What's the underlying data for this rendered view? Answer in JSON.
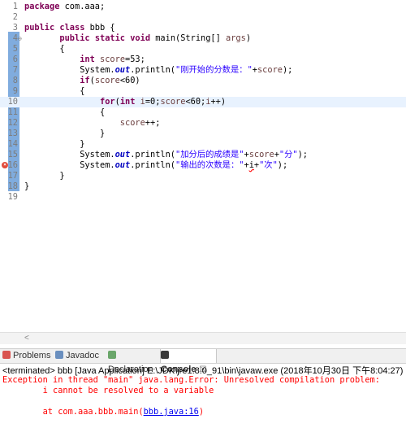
{
  "editor": {
    "lines": [
      {
        "n": "1",
        "code": [
          {
            "t": "package",
            "k": "kw"
          },
          {
            "t": " com.aaa;",
            "k": ""
          }
        ]
      },
      {
        "n": "2",
        "code": []
      },
      {
        "n": "3",
        "code": [
          {
            "t": "public",
            "k": "kw"
          },
          {
            "t": " ",
            "k": ""
          },
          {
            "t": "class",
            "k": "kw"
          },
          {
            "t": " bbb {",
            "k": ""
          }
        ]
      },
      {
        "n": "4",
        "fold": "⊖",
        "code": [
          {
            "t": "       ",
            "k": ""
          },
          {
            "t": "public",
            "k": "kw"
          },
          {
            "t": " ",
            "k": ""
          },
          {
            "t": "static",
            "k": "kw"
          },
          {
            "t": " ",
            "k": ""
          },
          {
            "t": "void",
            "k": "kw"
          },
          {
            "t": " main(String[] ",
            "k": ""
          },
          {
            "t": "args",
            "k": "var"
          },
          {
            "t": ")",
            "k": ""
          }
        ]
      },
      {
        "n": "5",
        "code": [
          {
            "t": "       {",
            "k": ""
          }
        ]
      },
      {
        "n": "6",
        "code": [
          {
            "t": "           ",
            "k": ""
          },
          {
            "t": "int",
            "k": "kw"
          },
          {
            "t": " ",
            "k": ""
          },
          {
            "t": "score",
            "k": "var"
          },
          {
            "t": "=53;",
            "k": ""
          }
        ]
      },
      {
        "n": "7",
        "code": [
          {
            "t": "           System.",
            "k": ""
          },
          {
            "t": "out",
            "k": "fld"
          },
          {
            "t": ".println(",
            "k": ""
          },
          {
            "t": "\"刚开始的分数是：\"",
            "k": "str"
          },
          {
            "t": "+",
            "k": ""
          },
          {
            "t": "score",
            "k": "var"
          },
          {
            "t": ");",
            "k": ""
          }
        ]
      },
      {
        "n": "8",
        "code": [
          {
            "t": "           ",
            "k": ""
          },
          {
            "t": "if",
            "k": "kw"
          },
          {
            "t": "(",
            "k": ""
          },
          {
            "t": "score",
            "k": "var"
          },
          {
            "t": "<60)",
            "k": ""
          }
        ]
      },
      {
        "n": "9",
        "code": [
          {
            "t": "           {",
            "k": ""
          }
        ]
      },
      {
        "n": "10",
        "current": true,
        "code": [
          {
            "t": "               ",
            "k": ""
          },
          {
            "t": "for",
            "k": "kw"
          },
          {
            "t": "(",
            "k": ""
          },
          {
            "t": "int",
            "k": "kw"
          },
          {
            "t": " ",
            "k": ""
          },
          {
            "t": "i",
            "k": "var"
          },
          {
            "t": "=0;",
            "k": ""
          },
          {
            "t": "score",
            "k": "var"
          },
          {
            "t": "<60;",
            "k": ""
          },
          {
            "t": "i",
            "k": "var"
          },
          {
            "t": "++)",
            "k": ""
          }
        ]
      },
      {
        "n": "11",
        "code": [
          {
            "t": "               {",
            "k": ""
          }
        ]
      },
      {
        "n": "12",
        "code": [
          {
            "t": "                   ",
            "k": ""
          },
          {
            "t": "score",
            "k": "var"
          },
          {
            "t": "++;",
            "k": ""
          }
        ]
      },
      {
        "n": "13",
        "code": [
          {
            "t": "               }",
            "k": ""
          }
        ]
      },
      {
        "n": "14",
        "code": [
          {
            "t": "           }",
            "k": ""
          }
        ]
      },
      {
        "n": "15",
        "code": [
          {
            "t": "           System.",
            "k": ""
          },
          {
            "t": "out",
            "k": "fld"
          },
          {
            "t": ".println(",
            "k": ""
          },
          {
            "t": "\"加分后的成绩是\"",
            "k": "str"
          },
          {
            "t": "+",
            "k": ""
          },
          {
            "t": "score",
            "k": "var"
          },
          {
            "t": "+",
            "k": ""
          },
          {
            "t": "\"分\"",
            "k": "str"
          },
          {
            "t": ");",
            "k": ""
          }
        ]
      },
      {
        "n": "16",
        "error": true,
        "code": [
          {
            "t": "           System.",
            "k": ""
          },
          {
            "t": "out",
            "k": "fld"
          },
          {
            "t": ".println(",
            "k": ""
          },
          {
            "t": "\"输出的次数是：\"",
            "k": "str"
          },
          {
            "t": "+",
            "k": ""
          },
          {
            "t": "i",
            "k": "err"
          },
          {
            "t": "+",
            "k": ""
          },
          {
            "t": "\"次\"",
            "k": "str"
          },
          {
            "t": ");",
            "k": ""
          }
        ]
      },
      {
        "n": "17",
        "code": [
          {
            "t": "       }",
            "k": ""
          }
        ]
      },
      {
        "n": "18",
        "code": [
          {
            "t": "}",
            "k": ""
          }
        ]
      },
      {
        "n": "19",
        "code": []
      }
    ],
    "scroll_arrow": "<"
  },
  "tabs": [
    {
      "label": "Problems",
      "icon": "problems-icon",
      "color": "#d9534f"
    },
    {
      "label": "Javadoc",
      "icon": "javadoc-icon",
      "color": "#6a8fbf"
    },
    {
      "label": "Declaration",
      "icon": "declaration-icon",
      "color": "#6aa66a"
    },
    {
      "label": "Console",
      "icon": "console-icon",
      "color": "#3b3b3b",
      "active": true,
      "close": "☒"
    }
  ],
  "status": "<terminated> bbb [Java Application] E:\\JDK\\jre1.8.0_91\\bin\\javaw.exe (2018年10月30日 下午8:04:27)",
  "console": {
    "line1": "Exception in thread \"main\" java.lang.Error: Unresolved compilation problem:",
    "line2": "\ti cannot be resolved to a variable",
    "line3": "",
    "line4_prefix": "\tat com.aaa.bbb.main(",
    "line4_link": "bbb.java:16",
    "line4_suffix": ")"
  }
}
